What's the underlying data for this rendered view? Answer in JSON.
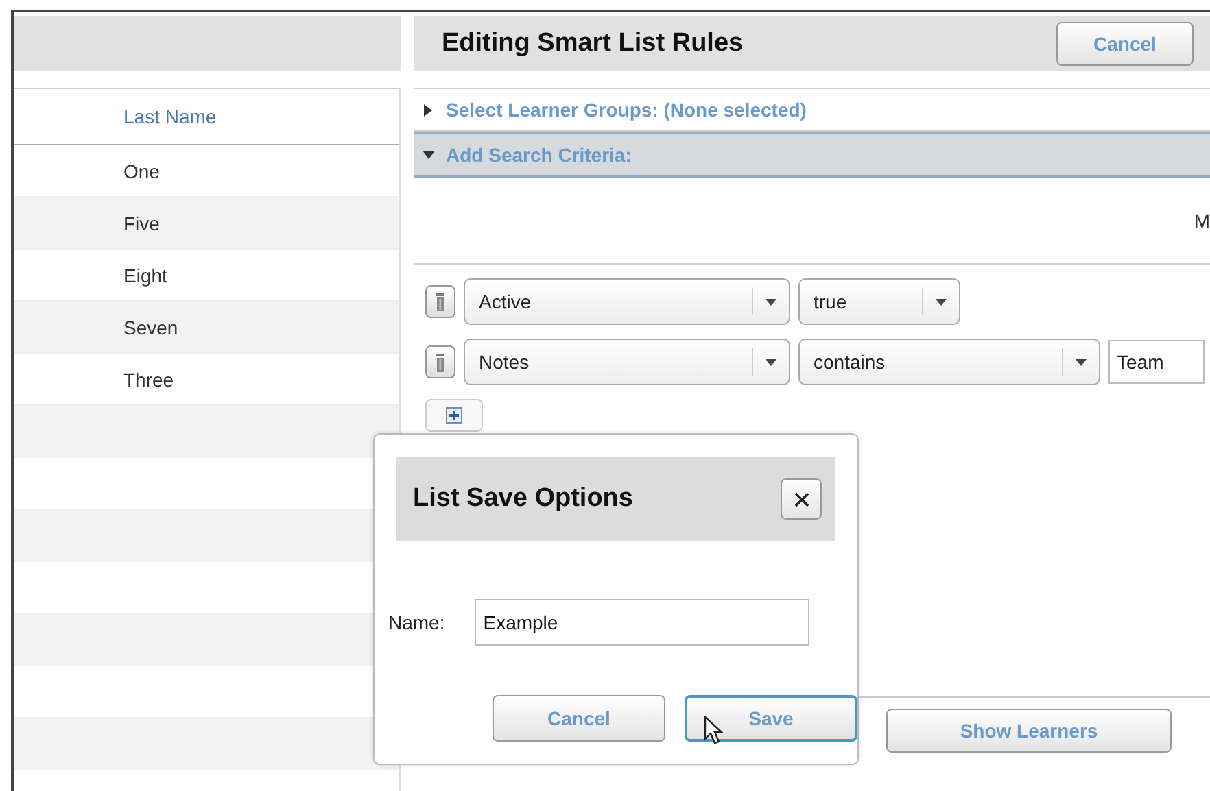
{
  "list": {
    "column": "Last Name",
    "rows": [
      "One",
      "Five",
      "Eight",
      "Seven",
      "Three"
    ]
  },
  "editor": {
    "title": "Editing Smart List Rules",
    "cancel": "Cancel",
    "sections": [
      {
        "label": "Select Learner Groups: (None selected)",
        "expanded": false
      },
      {
        "label": "Add Search Criteria:",
        "expanded": true
      }
    ],
    "edge_text": "M",
    "criteria": [
      {
        "field": "Active",
        "operator": "true",
        "kind": "choice"
      },
      {
        "field": "Notes",
        "operator": "contains",
        "value": "Team",
        "kind": "text"
      }
    ],
    "show_button": "Show Learners"
  },
  "dialog": {
    "title": "List Save Options",
    "name_label": "Name:",
    "name_value": "Example",
    "cancel": "Cancel",
    "save": "Save",
    "save_focused": true
  }
}
